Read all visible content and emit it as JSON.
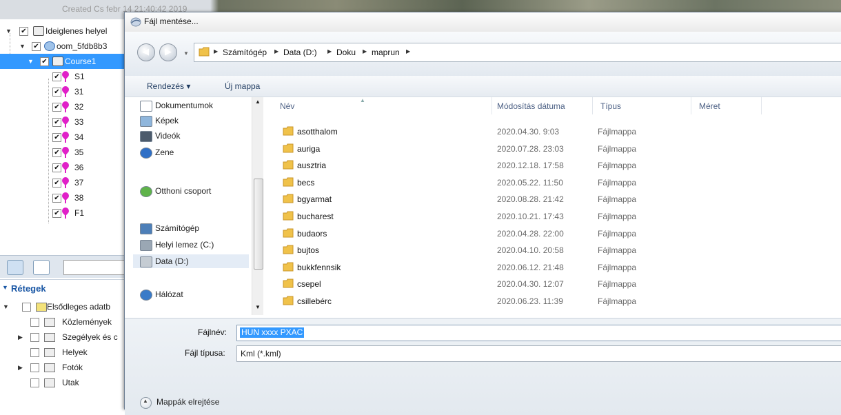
{
  "background": {
    "created_text": "Created Cs febr 14 21:40:42 2019",
    "places": [
      {
        "label": "Ideiglenes helyel",
        "checked": true
      },
      {
        "label": "oom_5fdb8b3",
        "checked": true
      },
      {
        "label": "Course1",
        "checked": true
      },
      {
        "label": "S1",
        "checked": true
      },
      {
        "label": "31",
        "checked": true
      },
      {
        "label": "32",
        "checked": true
      },
      {
        "label": "33",
        "checked": true
      },
      {
        "label": "34",
        "checked": true
      },
      {
        "label": "35",
        "checked": true
      },
      {
        "label": "36",
        "checked": true
      },
      {
        "label": "37",
        "checked": true
      },
      {
        "label": "38",
        "checked": true
      },
      {
        "label": "F1",
        "checked": true
      }
    ],
    "layers_title": "Rétegek",
    "layers": [
      {
        "label": "Elsődleges adatb"
      },
      {
        "label": "Közlemények"
      },
      {
        "label": "Szegélyek és c"
      },
      {
        "label": "Helyek"
      },
      {
        "label": "Fotók"
      },
      {
        "label": "Utak"
      }
    ]
  },
  "dialog": {
    "title": "Fájl mentése...",
    "breadcrumb": [
      "Számítógép",
      "Data (D:)",
      "Doku",
      "maprun"
    ],
    "toolbar": {
      "organize": "Rendezés ▾",
      "new_folder": "Új mappa"
    },
    "nav_items": [
      {
        "label": "Dokumentumok",
        "icon": "documents-icon"
      },
      {
        "label": "Képek",
        "icon": "pictures-icon"
      },
      {
        "label": "Videók",
        "icon": "videos-icon"
      },
      {
        "label": "Zene",
        "icon": "music-icon"
      },
      {
        "label": "Otthoni csoport",
        "icon": "homegroup-icon"
      },
      {
        "label": "Számítógép",
        "icon": "computer-icon"
      },
      {
        "label": "Helyi lemez (C:)",
        "icon": "drive-c-icon"
      },
      {
        "label": "Data (D:)",
        "icon": "drive-d-icon"
      },
      {
        "label": "Hálózat",
        "icon": "network-icon"
      }
    ],
    "columns": {
      "name": "Név",
      "modified": "Módosítás dátuma",
      "type": "Típus",
      "size": "Méret"
    },
    "files": [
      {
        "name": "asotthalom",
        "modified": "2020.04.30. 9:03",
        "type": "Fájlmappa"
      },
      {
        "name": "auriga",
        "modified": "2020.07.28. 23:03",
        "type": "Fájlmappa"
      },
      {
        "name": "ausztria",
        "modified": "2020.12.18. 17:58",
        "type": "Fájlmappa"
      },
      {
        "name": "becs",
        "modified": "2020.05.22. 11:50",
        "type": "Fájlmappa"
      },
      {
        "name": "bgyarmat",
        "modified": "2020.08.28. 21:42",
        "type": "Fájlmappa"
      },
      {
        "name": "bucharest",
        "modified": "2020.10.21. 17:43",
        "type": "Fájlmappa"
      },
      {
        "name": "budaors",
        "modified": "2020.04.28. 22:00",
        "type": "Fájlmappa"
      },
      {
        "name": "bujtos",
        "modified": "2020.04.10. 20:58",
        "type": "Fájlmappa"
      },
      {
        "name": "bukkfennsik",
        "modified": "2020.06.12. 21:48",
        "type": "Fájlmappa"
      },
      {
        "name": "csepel",
        "modified": "2020.04.30. 12:07",
        "type": "Fájlmappa"
      },
      {
        "name": "csillebérc",
        "modified": "2020.06.23. 11:39",
        "type": "Fájlmappa"
      }
    ],
    "filename_label": "Fájlnév:",
    "filename_value": "HUN xxxx PXAC",
    "filetype_label": "Fájl típusa:",
    "filetype_value": "Kml (*.kml)",
    "hide_folders": "Mappák elrejtése"
  }
}
